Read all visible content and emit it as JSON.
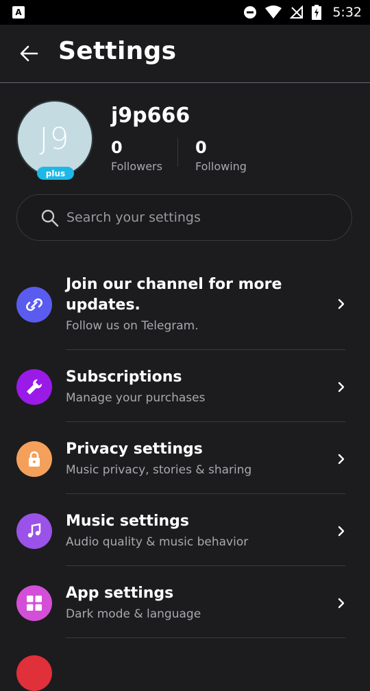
{
  "status_bar": {
    "notification_icon": "a-letter-icon",
    "time": "5:32"
  },
  "app_bar": {
    "title": "Settings",
    "back_icon": "arrow-left-icon"
  },
  "profile": {
    "initials": "J9",
    "badge": "plus",
    "username": "j9p666",
    "followers_count": "0",
    "followers_label": "Followers",
    "following_count": "0",
    "following_label": "Following"
  },
  "search": {
    "placeholder": "Search your settings"
  },
  "menu": {
    "items": [
      {
        "title": "Join our channel for more updates.",
        "subtitle": "Follow us on Telegram.",
        "icon": "link-icon",
        "color": "#5a5cf0"
      },
      {
        "title": "Subscriptions",
        "subtitle": "Manage your purchases",
        "icon": "wrench-icon",
        "color": "#9a1ae8"
      },
      {
        "title": "Privacy settings",
        "subtitle": "Music privacy, stories & sharing",
        "icon": "lock-icon",
        "color": "#f5a05a"
      },
      {
        "title": "Music settings",
        "subtitle": "Audio quality & music behavior",
        "icon": "music-note-icon",
        "color": "#9a52e8"
      },
      {
        "title": "App settings",
        "subtitle": "Dark mode & language",
        "icon": "grid-icon",
        "color": "#d44fd8"
      }
    ]
  },
  "colors": {
    "background": "#1c1c1e",
    "plus_badge": "#1fb8e6",
    "avatar_bg": "#c4dbe1"
  }
}
